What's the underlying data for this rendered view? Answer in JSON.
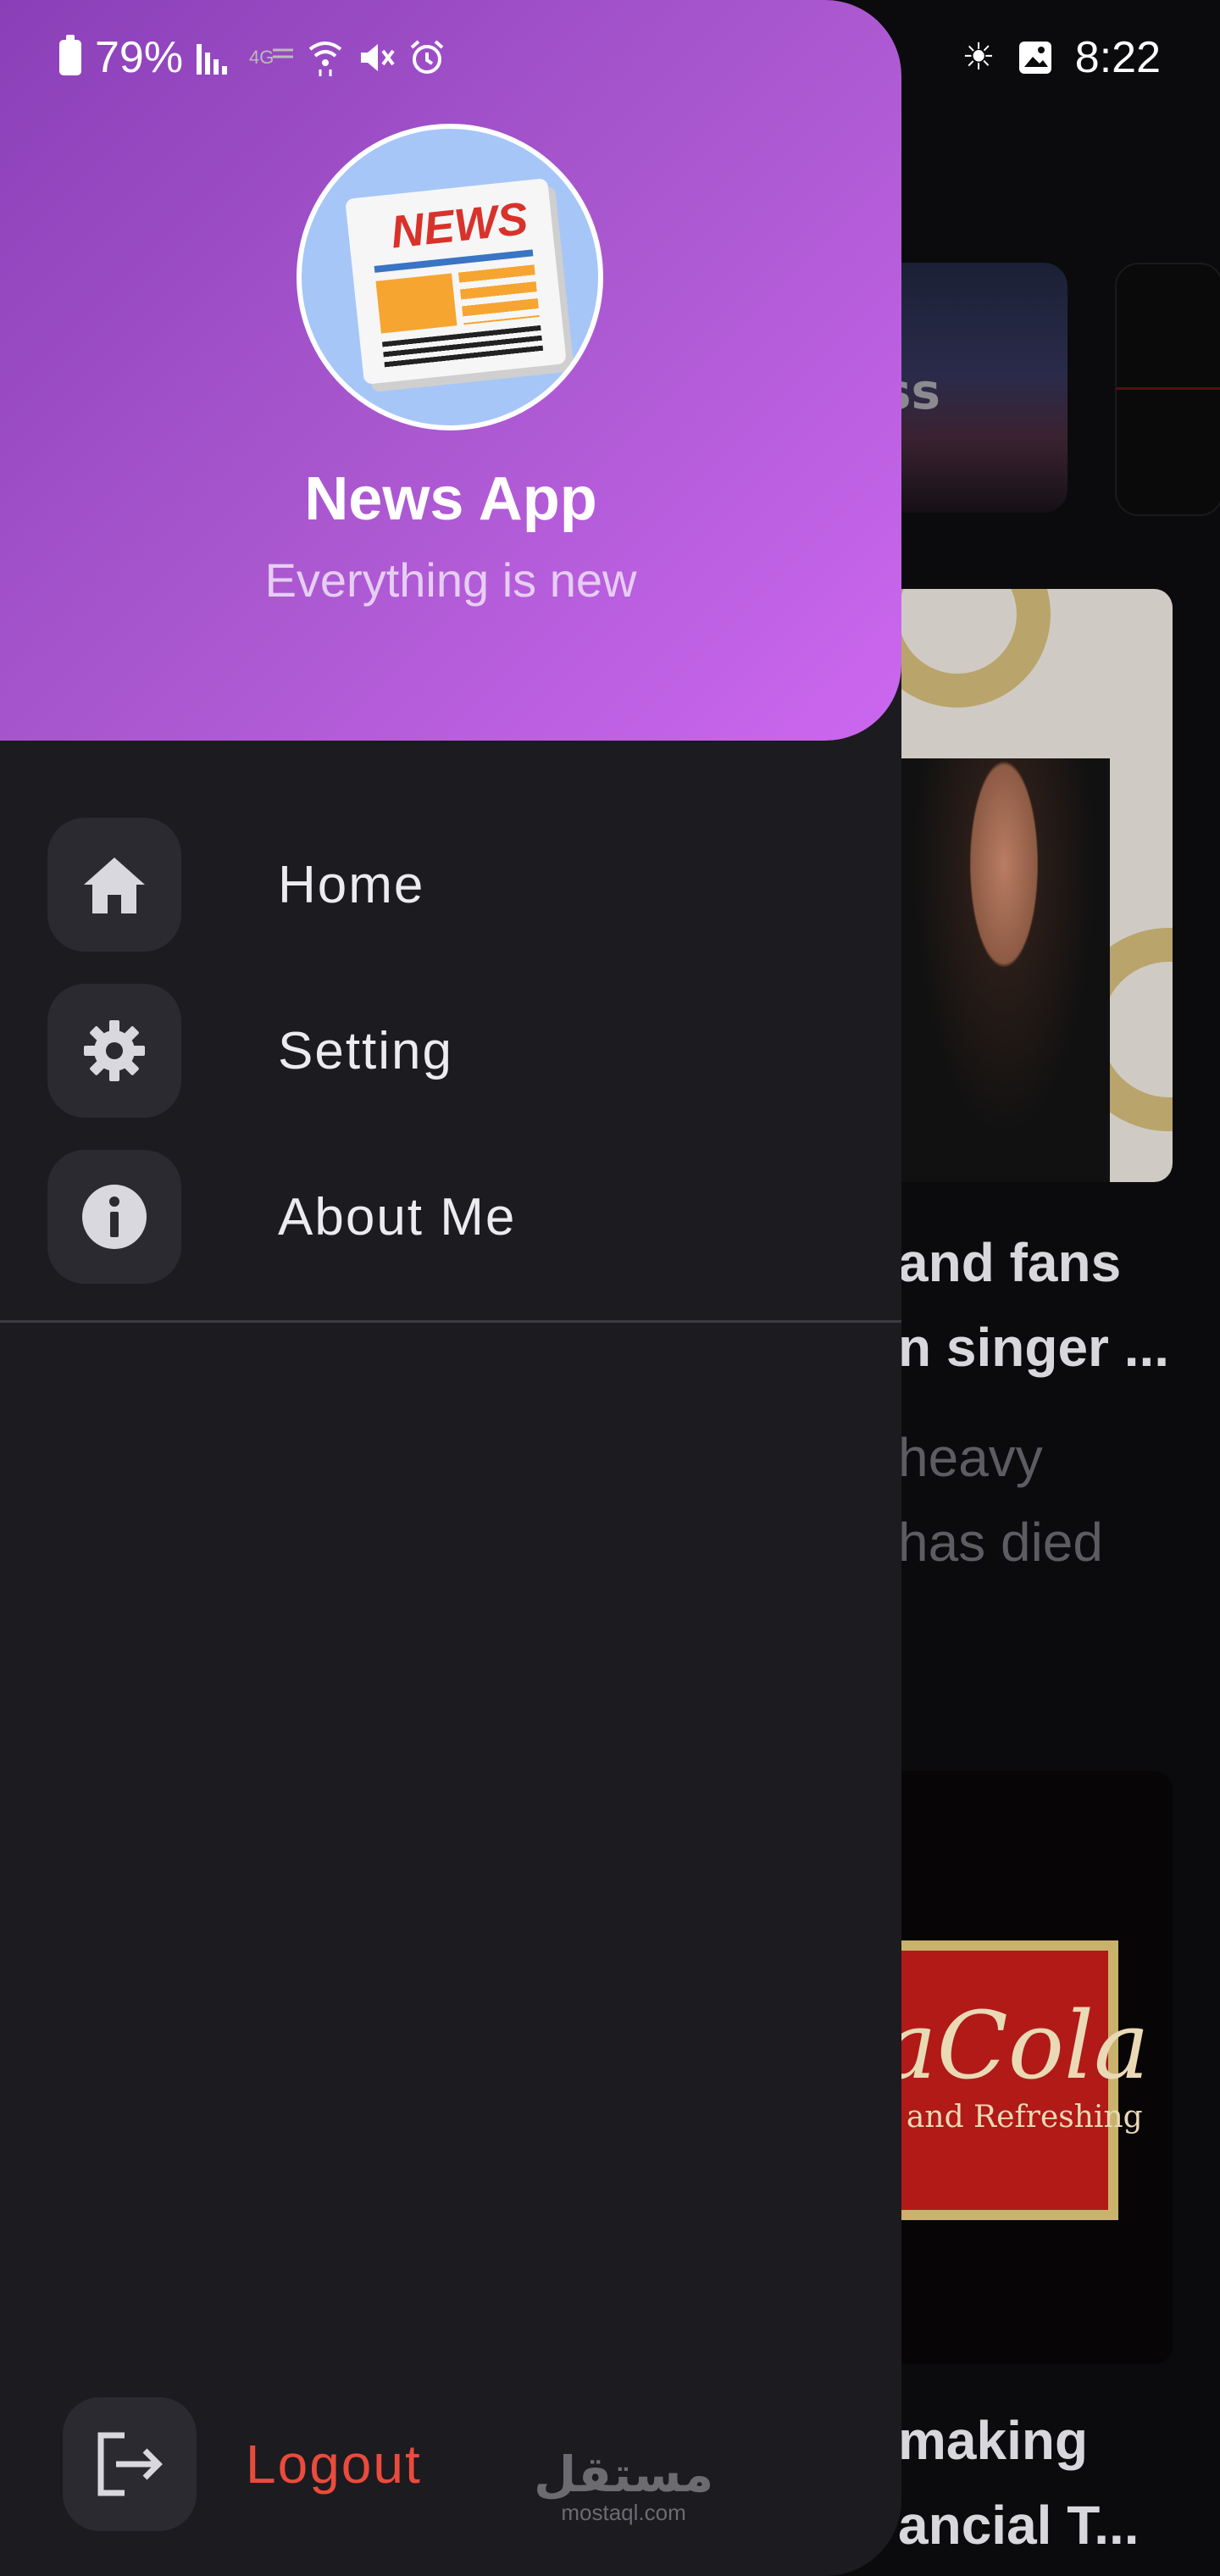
{
  "status_bar": {
    "battery": "79%",
    "time": "8:22",
    "icons_left": [
      "battery-icon",
      "signal-icon",
      "4g-icon",
      "wifi-icon",
      "mute-icon",
      "alarm-icon"
    ],
    "icons_right": [
      "brightness-icon",
      "gallery-icon"
    ]
  },
  "drawer": {
    "app_title": "News App",
    "app_subtitle": "Everything is new",
    "avatar_text": "NEWS",
    "header_gradient": [
      "#8a3fb8",
      "#cc67f0"
    ],
    "menu": [
      {
        "label": "Home",
        "icon": "home-icon"
      },
      {
        "label": "Setting",
        "icon": "gear-icon"
      },
      {
        "label": "About Me",
        "icon": "info-icon"
      }
    ],
    "logout": {
      "label": "Logout",
      "icon": "logout-icon",
      "color": "#ea4b3c"
    }
  },
  "background_feed": {
    "category_label": "ss",
    "article1": {
      "headline_lines": [
        "and fans",
        "n singer ..."
      ],
      "summary_lines": [
        "heavy",
        "has died"
      ]
    },
    "article2": {
      "image_text": "aCola",
      "image_subtext": "s and Refreshing",
      "headline_lines": [
        "making",
        "ancial T..."
      ]
    }
  },
  "watermark": {
    "arabic": "مستقل",
    "latin": "mostaql.com"
  }
}
